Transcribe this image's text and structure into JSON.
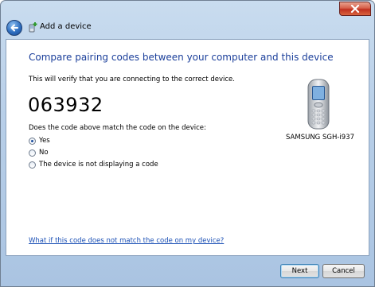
{
  "window": {
    "title": "Add a device"
  },
  "main": {
    "heading": "Compare pairing codes between your computer and this device",
    "description": "This will verify that you are connecting to the correct device.",
    "code": "063932",
    "question": "Does the code above match the code on the device:",
    "options": [
      {
        "label": "Yes",
        "selected": true
      },
      {
        "label": "No",
        "selected": false
      },
      {
        "label": "The device is not displaying a code",
        "selected": false
      }
    ],
    "device_name": "SAMSUNG SGH-i937",
    "help_link": "What if this code does not match the code on my device?"
  },
  "buttons": {
    "next": "Next",
    "cancel": "Cancel"
  },
  "icons": {
    "back": "back-arrow-icon",
    "title": "add-device-icon",
    "close": "close-icon",
    "device": "mobile-phone-icon"
  },
  "colors": {
    "heading": "#1a3e9a",
    "link": "#1a4fb5",
    "close": "#c0301f"
  }
}
